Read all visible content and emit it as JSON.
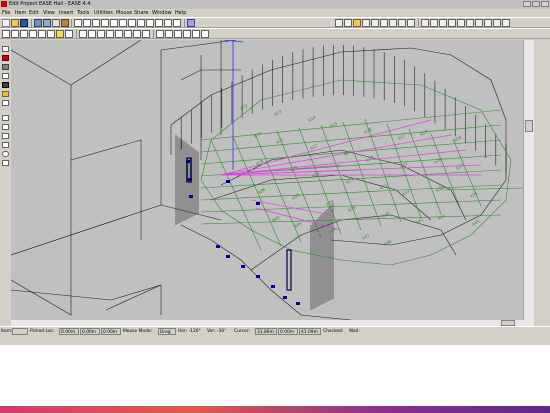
{
  "window": {
    "title": "Edit Project EASE Hall - EASE 4.4"
  },
  "menu": [
    "File",
    "Item",
    "Edit",
    "View",
    "Insert",
    "Tools",
    "Utilities",
    "Mouse",
    "Share",
    "Window",
    "Help"
  ],
  "viewport_labels": [
    "A12",
    "A13",
    "A14",
    "A15",
    "A16",
    "A17",
    "A18",
    "A19",
    "A20",
    "A21",
    "A22",
    "A23",
    "A24",
    "A25",
    "A26",
    "A27",
    "A28",
    "A29",
    "A30",
    "A31",
    "A32",
    "A33",
    "A34",
    "A35",
    "A36",
    "A37",
    "A38",
    "A39",
    "A40",
    "A41",
    "A42",
    "A43",
    "A44",
    "A45",
    "A46",
    "A47",
    "A48"
  ],
  "status": {
    "item_label": "Item:",
    "picked_label": "Picked Loc:",
    "picked_x": "0.00m",
    "picked_y": "0.00m",
    "picked_z": "0.00m",
    "mouse_mode": "Mouse Mode:",
    "mode_value": "Drag",
    "hor": "Hor: -120°",
    "ver": "Ver: -30°",
    "cursor_label": "Cursor:",
    "cursor_x": "31.86m",
    "cursor_y": "0.00m",
    "cursor_z": "41.09m",
    "checked": "Checked:",
    "checked_value": "Wall:"
  },
  "colors": {
    "chrome": "#d4d0c8",
    "viewport_bg": "#c0c0c0",
    "wireframe": "#202020",
    "audience_lines": "#2f8a2f",
    "speaker_rays": "#e040e0",
    "axis": "#3030ff",
    "speaker": "#0000a0"
  }
}
